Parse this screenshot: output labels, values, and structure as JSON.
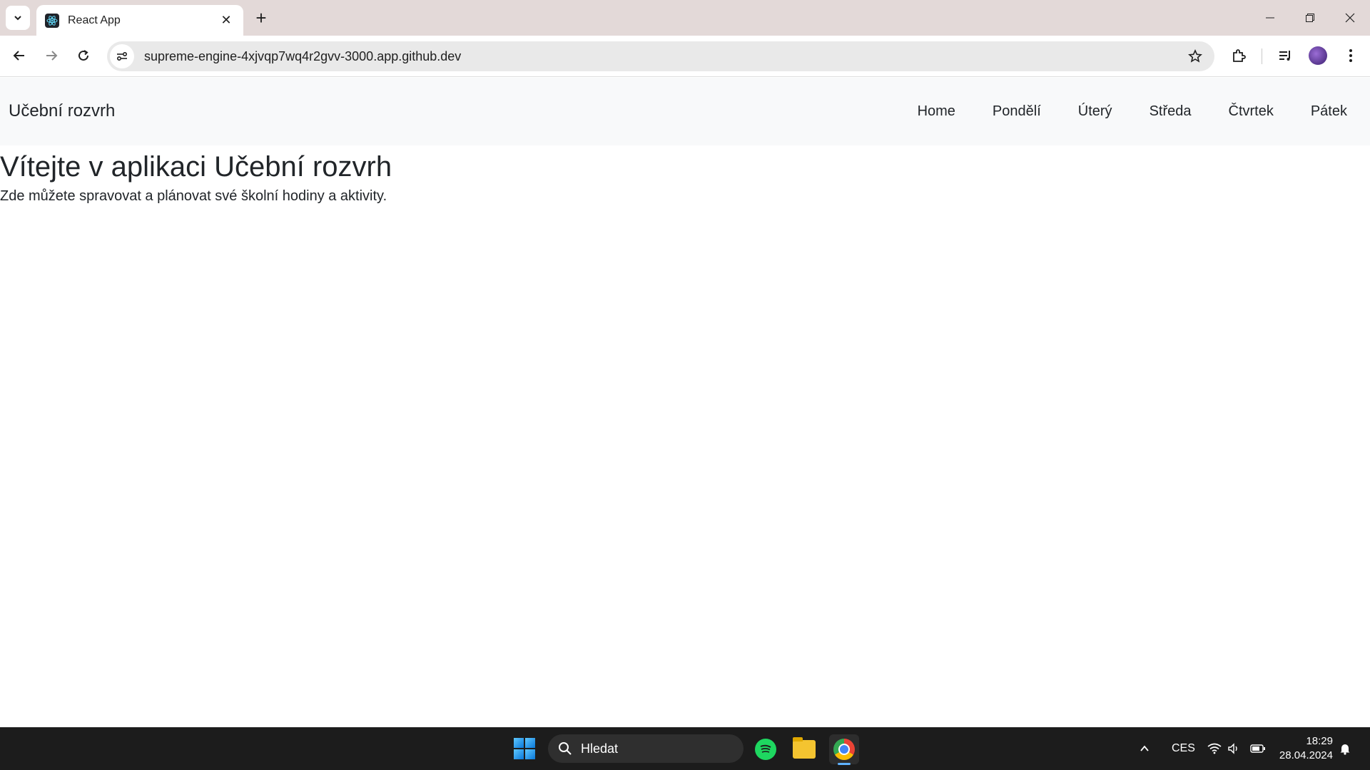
{
  "browser": {
    "tab_title": "React App",
    "url": "supreme-engine-4xjvqp7wq4r2gvv-3000.app.github.dev"
  },
  "navbar": {
    "brand": "Učební rozvrh",
    "links": [
      {
        "label": "Home"
      },
      {
        "label": "Pondělí"
      },
      {
        "label": "Úterý"
      },
      {
        "label": "Středa"
      },
      {
        "label": "Čtvrtek"
      },
      {
        "label": "Pátek"
      }
    ]
  },
  "main": {
    "title": "Vítejte v aplikaci Učební rozvrh",
    "text": "Zde můžete spravovat a plánovat své školní hodiny a aktivity."
  },
  "taskbar": {
    "search_label": "Hledat",
    "language": "CES",
    "time": "18:29",
    "date": "28.04.2024"
  }
}
